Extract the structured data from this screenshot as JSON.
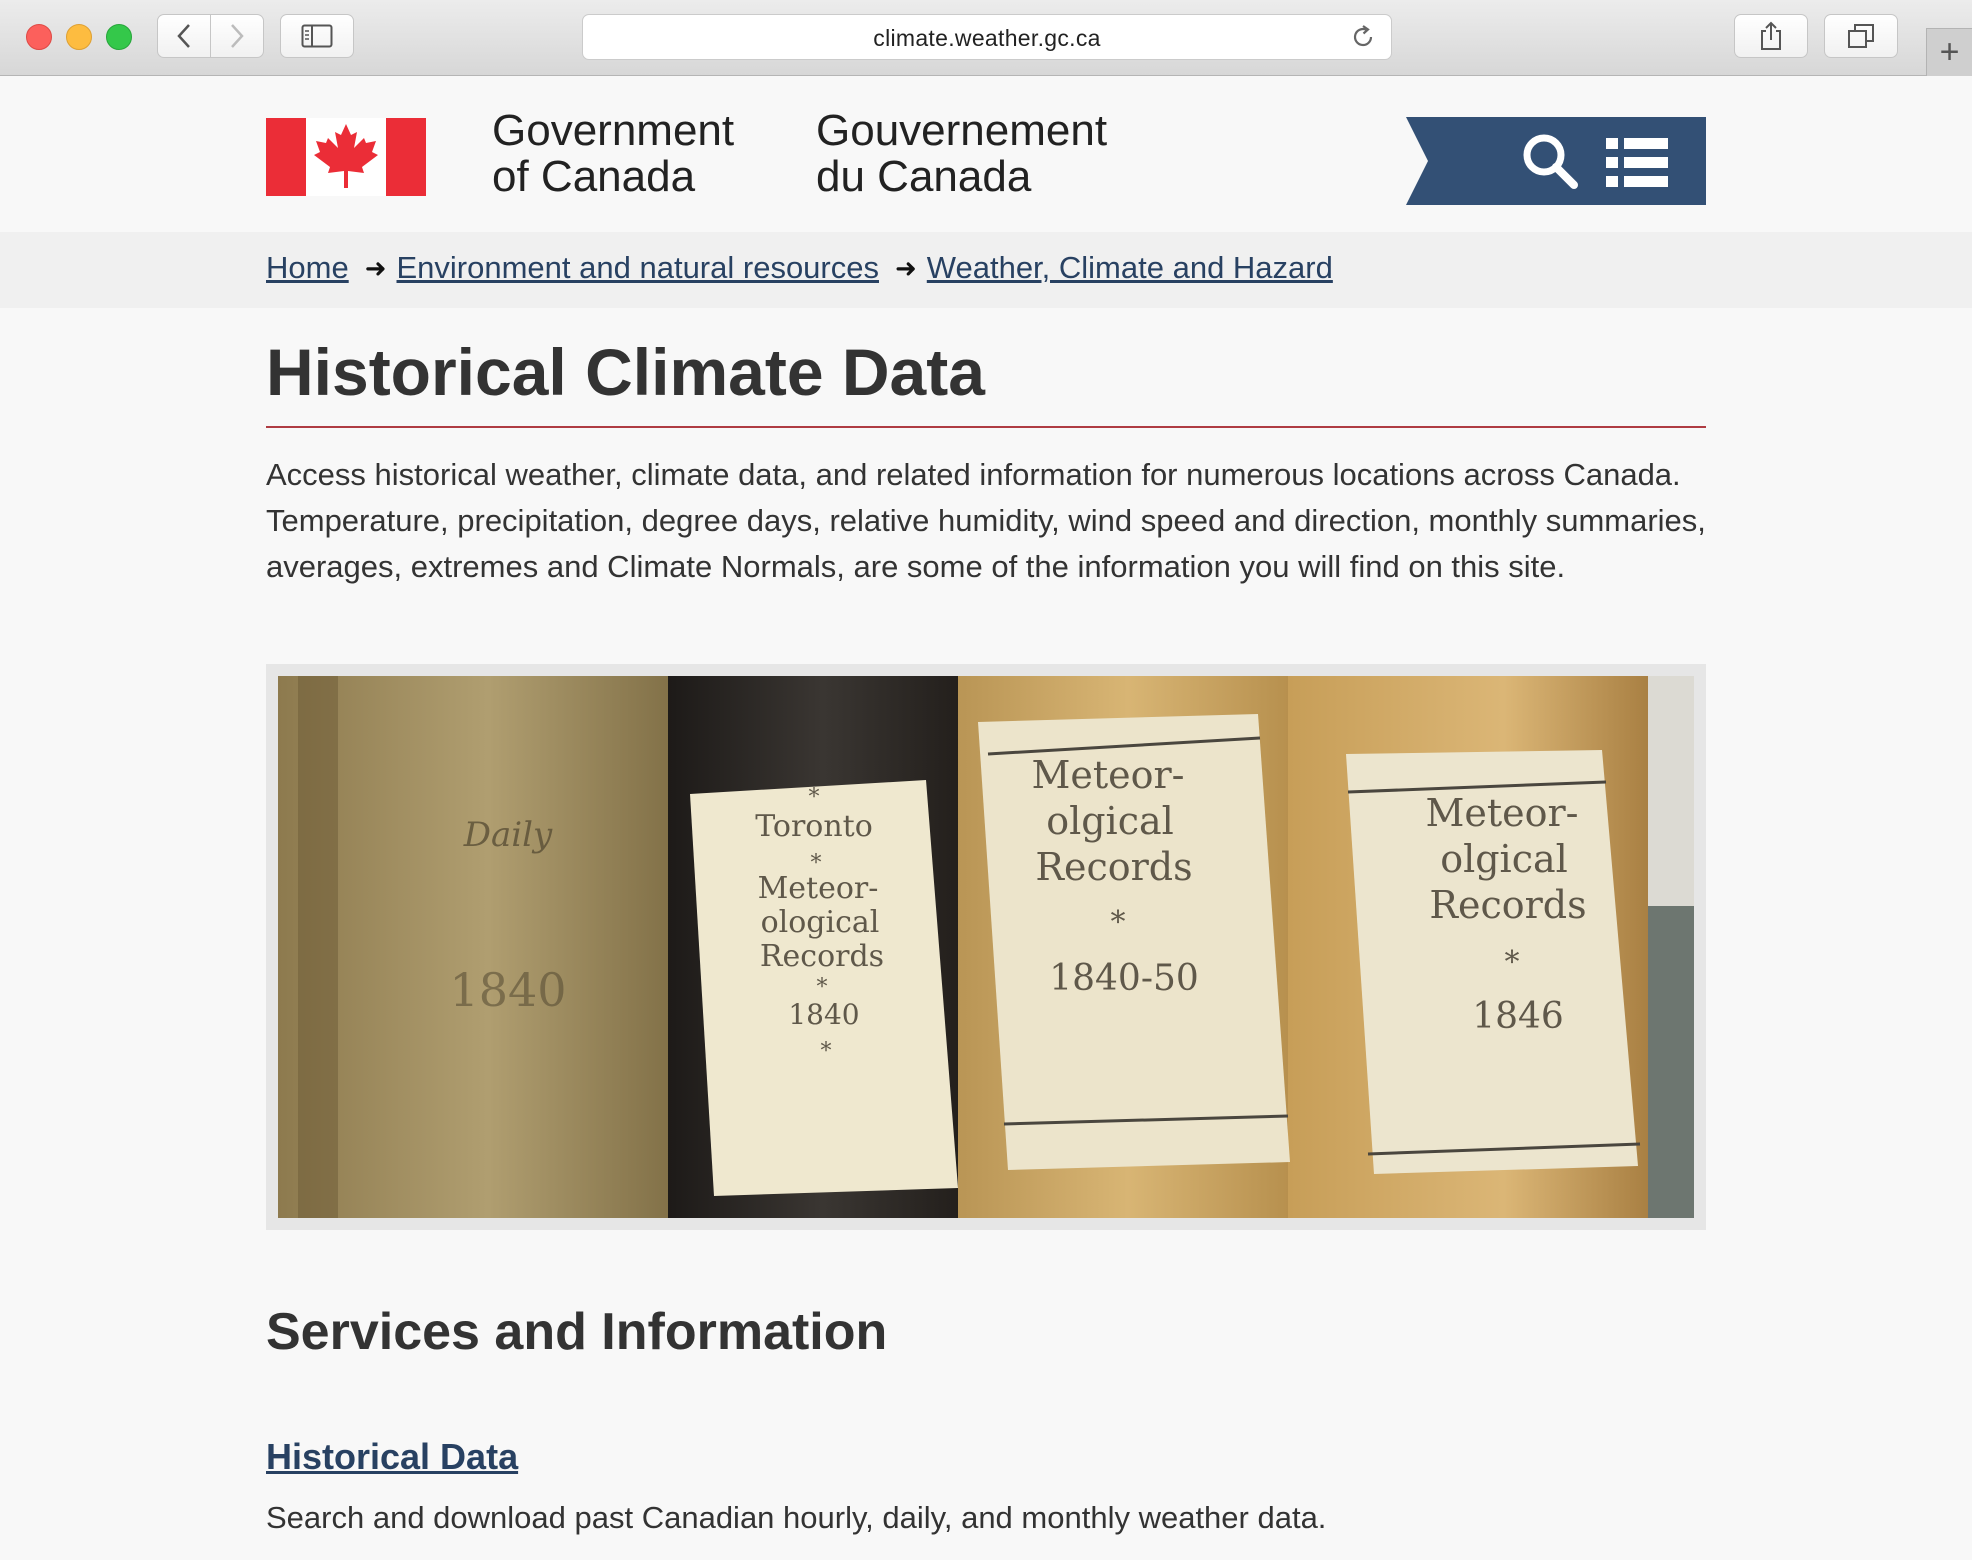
{
  "browser": {
    "url": "climate.weather.gc.ca"
  },
  "header": {
    "gov_en_line1": "Government",
    "gov_en_line2": "of Canada",
    "gov_fr_line1": "Gouvernement",
    "gov_fr_line2": "du Canada",
    "colors": {
      "flag_red": "#eb2d37",
      "banner": "#335075"
    }
  },
  "breadcrumb": [
    {
      "label": "Home"
    },
    {
      "label": "Environment and natural resources"
    },
    {
      "label": "Weather, Climate and Hazard"
    }
  ],
  "main": {
    "title": "Historical Climate Data",
    "intro": "Access historical weather, climate data, and related information for numerous locations across Canada. Temperature, precipitation, degree days, relative humidity, wind speed and direction, monthly summaries, averages, extremes and Climate Normals, are some of the information you will find on this site.",
    "hero_books": [
      {
        "lines": [
          "Daily",
          "",
          "",
          "1840"
        ]
      },
      {
        "lines": [
          "*",
          "Toronto",
          "*",
          "Meteor-",
          "ological",
          "Records",
          "*",
          "1840",
          "*"
        ]
      },
      {
        "lines": [
          "Meteor-",
          "olgical",
          "Records",
          "*",
          "1840-50"
        ]
      },
      {
        "lines": [
          "Meteor-",
          "olgical",
          "Records",
          "*",
          "1846"
        ]
      }
    ],
    "section_title": "Services and Information",
    "services": [
      {
        "link": "Historical Data",
        "description": "Search and download past Canadian hourly, daily, and monthly weather data."
      }
    ]
  }
}
